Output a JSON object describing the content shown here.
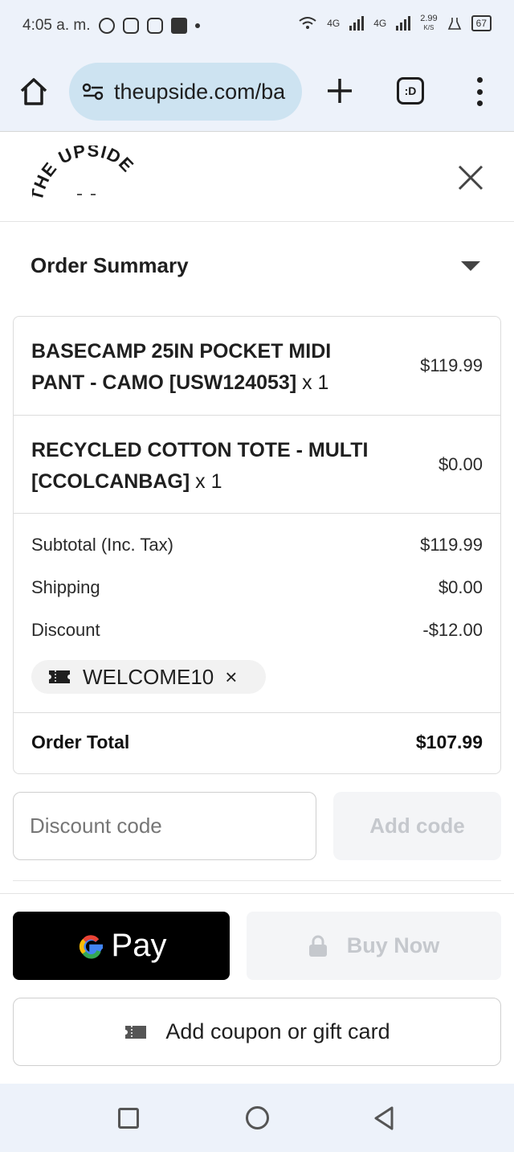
{
  "status_bar": {
    "time": "4:05 a. m.",
    "data_speed": "2.99",
    "data_unit": "K/S",
    "net1": "4G",
    "net2": "4G",
    "battery": "67"
  },
  "browser": {
    "url": "theupside.com/ba",
    "tabs_label": ":D"
  },
  "header": {
    "logo_text": "THE UPSIDE"
  },
  "summary": {
    "title": "Order Summary",
    "items": [
      {
        "name": "BASECAMP 25IN POCKET MIDI PANT - CAMO [USW124053]",
        "qty": "x 1",
        "price": "$119.99"
      },
      {
        "name": "RECYCLED COTTON TOTE - MULTI [CCOLCANBAG]",
        "qty": "x 1",
        "price": "$0.00"
      }
    ],
    "subtotal": {
      "label": "Subtotal (Inc. Tax)",
      "value": "$119.99"
    },
    "shipping": {
      "label": "Shipping",
      "value": "$0.00"
    },
    "discount": {
      "label": "Discount",
      "value": "-$12.00"
    },
    "coupon": {
      "code": "WELCOME10",
      "remove": "×"
    },
    "total": {
      "label": "Order Total",
      "value": "$107.99"
    }
  },
  "discount_entry": {
    "placeholder": "Discount code",
    "button": "Add code"
  },
  "payment": {
    "gpay_label": "Pay",
    "buy_now": "Buy Now",
    "coupon_button": "Add coupon or gift card"
  },
  "colors": {
    "chrome_bg": "#edf2fa",
    "url_pill": "#cde3f1",
    "gpay_bg": "#000000",
    "disabled_btn": "#f4f5f7"
  }
}
